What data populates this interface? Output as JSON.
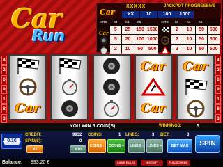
{
  "logo": {
    "word1": "Car",
    "word2": "Run"
  },
  "paytable": {
    "stars": "XXXXX",
    "jackpot_label": "JACKPOT PROGRESSIVE",
    "logo_text": "Car",
    "jackpot_values": [
      "XX",
      "10",
      "100",
      "1000"
    ],
    "left_header": [
      "HITS",
      "X3",
      "X4",
      "X5"
    ],
    "left_rows": [
      {
        "icon": "car-logo",
        "values": [
          "5",
          "25",
          "150",
          "1500"
        ]
      },
      {
        "icon": "tire-icon",
        "values": [
          "5",
          "20",
          "100",
          "1000"
        ]
      },
      {
        "icon": "stopwatch-icon",
        "values": [
          "2",
          "10",
          "50",
          "500"
        ]
      }
    ],
    "right_header": [
      "HITS",
      "X3",
      "X4",
      "X5"
    ],
    "right_rows": [
      {
        "icon": "checkered-flag-icon",
        "values": [
          "2",
          "10",
          "50",
          "500"
        ]
      },
      {
        "icon": "steering-wheel-icon",
        "values": [
          "2",
          "10",
          "50",
          "500"
        ]
      },
      {
        "icon": "warning-sign-icon",
        "values": [
          "2",
          "10",
          "50",
          "500"
        ]
      }
    ]
  },
  "side_numbers_left": [
    "4",
    "2",
    "6",
    "9",
    "1",
    "8",
    "3"
  ],
  "side_numbers_right": [
    "4",
    "2",
    "6",
    "9",
    "1",
    "8",
    "3"
  ],
  "reels": [
    [
      "checkered-flag-icon",
      "steering-wheel-icon",
      "car-logo"
    ],
    [
      "checkered-flag-icon",
      "stopwatch-icon",
      "tire-icon"
    ],
    [
      "tire-icon",
      "tire-icon",
      "stopwatch-icon"
    ],
    [
      "car-logo",
      "warning-sign-icon",
      "car-logo"
    ],
    [
      "car-logo",
      "checkered-flag-icon",
      "steering-wheel-icon"
    ]
  ],
  "status": {
    "win_message": "YOU WIN 5 COIN(S)",
    "winnings_label": "WINNINGS:",
    "winnings_value": "5"
  },
  "controls": {
    "coin_label": "0.1€",
    "credit_label": "CREDIT:",
    "credit_value": "9932",
    "spins_label": "SPIN(S):",
    "spins_value": "0",
    "coins_label": "COINS:",
    "coins_value": "1",
    "lines_label": "LINES:",
    "lines_value": "3",
    "bet_label": "BET:",
    "bet_value": "3",
    "btn_x5": "X5",
    "btn_x10": "X10",
    "btn_coins_minus": "COINS -",
    "btn_coins_plus": "COINS +",
    "btn_lines_minus": "LINES -",
    "btn_lines_plus": "LINES +",
    "btn_bet_max": "BET MAX",
    "btn_spin": "SPIN"
  },
  "bottom": {
    "balance_label": "Balance:",
    "balance_value": "993.20 €",
    "small_buttons": [
      "GAME RULES",
      "HISTORY",
      "FULLSCREEN"
    ]
  },
  "colors": {
    "accent_red": "#c01414",
    "gold": "#ffb400",
    "run_blue": "#4fb8ff",
    "panel_navy": "#0c2a88"
  }
}
